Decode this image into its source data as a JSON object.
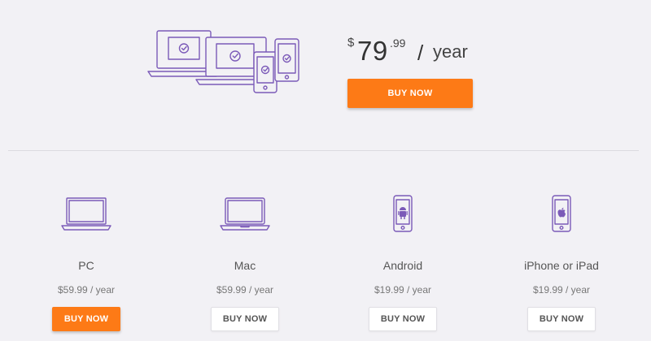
{
  "colors": {
    "accent": "#fd7a16",
    "icon_stroke": "#7b5ab8",
    "background": "#f2f1f5"
  },
  "hero": {
    "illustration_icon": "multi-device-icon",
    "price": {
      "currency": "$",
      "dollars": "79",
      "cents": ".99",
      "slash": "/",
      "period": "year"
    },
    "button_label": "BUY NOW"
  },
  "plans": [
    {
      "icon": "laptop-icon",
      "name": "PC",
      "price": "$59.99 / year",
      "button_label": "BUY NOW",
      "button_style": "filled"
    },
    {
      "icon": "laptop-icon",
      "name": "Mac",
      "price": "$59.99 / year",
      "button_label": "BUY NOW",
      "button_style": "outline"
    },
    {
      "icon": "android-phone-icon",
      "name": "Android",
      "price": "$19.99 / year",
      "button_label": "BUY NOW",
      "button_style": "outline"
    },
    {
      "icon": "iphone-icon",
      "name": "iPhone or iPad",
      "price": "$19.99 / year",
      "button_label": "BUY NOW",
      "button_style": "outline"
    }
  ]
}
